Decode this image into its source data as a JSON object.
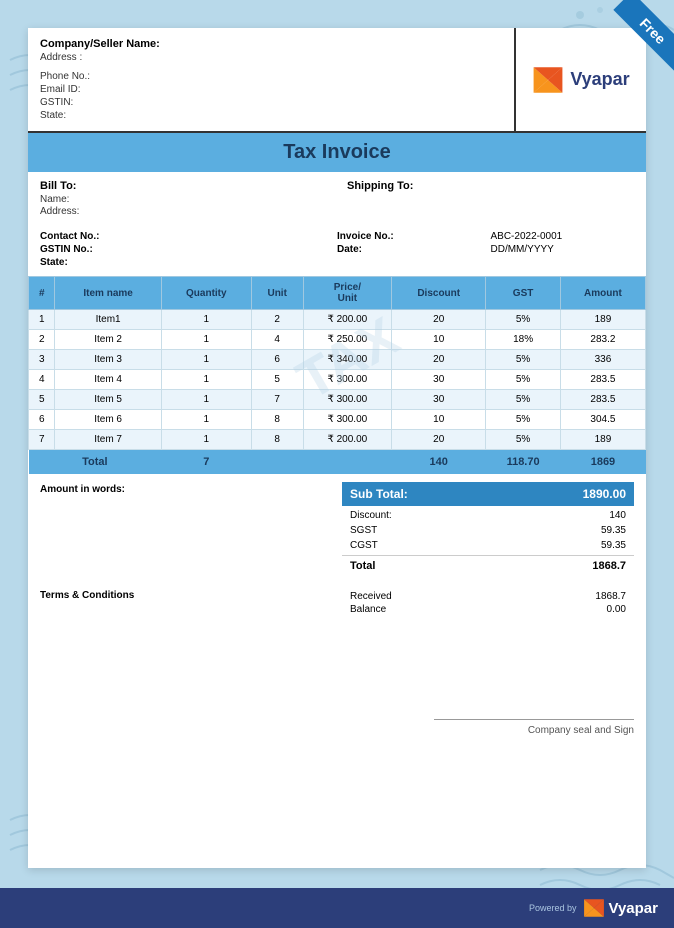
{
  "page": {
    "background_color": "#b8d9ea",
    "free_label": "Free"
  },
  "header": {
    "company_name_label": "Company/Seller Name:",
    "address_label": "Address :",
    "phone_label": "Phone No.:",
    "email_label": "Email ID:",
    "gstin_label": "GSTIN:",
    "state_label": "State:",
    "logo_text": "Vyapar",
    "powered_by": "Powered by"
  },
  "invoice_title": "Tax Invoice",
  "billing": {
    "bill_to_label": "Bill To:",
    "name_label": "Name:",
    "address_label": "Address:",
    "ship_to_label": "Shipping To:",
    "contact_label": "Contact No.:",
    "gstin_label": "GSTIN No.:",
    "state_label": "State:",
    "invoice_no_label": "Invoice No.:",
    "invoice_no_value": "ABC-2022-0001",
    "date_label": "Date:",
    "date_value": "DD/MM/YYYY"
  },
  "table": {
    "columns": [
      "#",
      "Item name",
      "Quantity",
      "Unit",
      "Price/\nUnit",
      "Discount",
      "GST",
      "Amount"
    ],
    "rows": [
      {
        "num": "1",
        "name": "Item1",
        "qty": "1",
        "unit": "2",
        "price": "₹  200.00",
        "discount": "20",
        "gst": "5%",
        "amount": "189"
      },
      {
        "num": "2",
        "name": "Item 2",
        "qty": "1",
        "unit": "4",
        "price": "₹  250.00",
        "discount": "10",
        "gst": "18%",
        "amount": "283.2"
      },
      {
        "num": "3",
        "name": "Item 3",
        "qty": "1",
        "unit": "6",
        "price": "₹  340.00",
        "discount": "20",
        "gst": "5%",
        "amount": "336"
      },
      {
        "num": "4",
        "name": "Item 4",
        "qty": "1",
        "unit": "5",
        "price": "₹  300.00",
        "discount": "30",
        "gst": "5%",
        "amount": "283.5"
      },
      {
        "num": "5",
        "name": "Item 5",
        "qty": "1",
        "unit": "7",
        "price": "₹  300.00",
        "discount": "30",
        "gst": "5%",
        "amount": "283.5"
      },
      {
        "num": "6",
        "name": "Item 6",
        "qty": "1",
        "unit": "8",
        "price": "₹  300.00",
        "discount": "10",
        "gst": "5%",
        "amount": "304.5"
      },
      {
        "num": "7",
        "name": "Item 7",
        "qty": "1",
        "unit": "8",
        "price": "₹  200.00",
        "discount": "20",
        "gst": "5%",
        "amount": "189"
      }
    ],
    "footer": {
      "total_label": "Total",
      "total_qty": "7",
      "total_discount": "140",
      "total_gst": "118.70",
      "total_amount": "1869"
    }
  },
  "summary": {
    "amount_words_label": "Amount in words:",
    "subtotal_label": "Sub Total:",
    "subtotal_value": "1890.00",
    "discount_label": "Discount:",
    "discount_value": "140",
    "sgst_label": "SGST",
    "sgst_value": "59.35",
    "cgst_label": "CGST",
    "cgst_value": "59.35",
    "total_label": "Total",
    "total_value": "1868.7",
    "received_label": "Received",
    "received_value": "1868.7",
    "balance_label": "Balance",
    "balance_value": "0.00"
  },
  "terms": {
    "label": "Terms & Conditions"
  },
  "footer": {
    "seal_label": "Company seal and Sign",
    "powered_by": "Powered by",
    "logo_text": "Vyapar"
  },
  "watermark": "TAX"
}
